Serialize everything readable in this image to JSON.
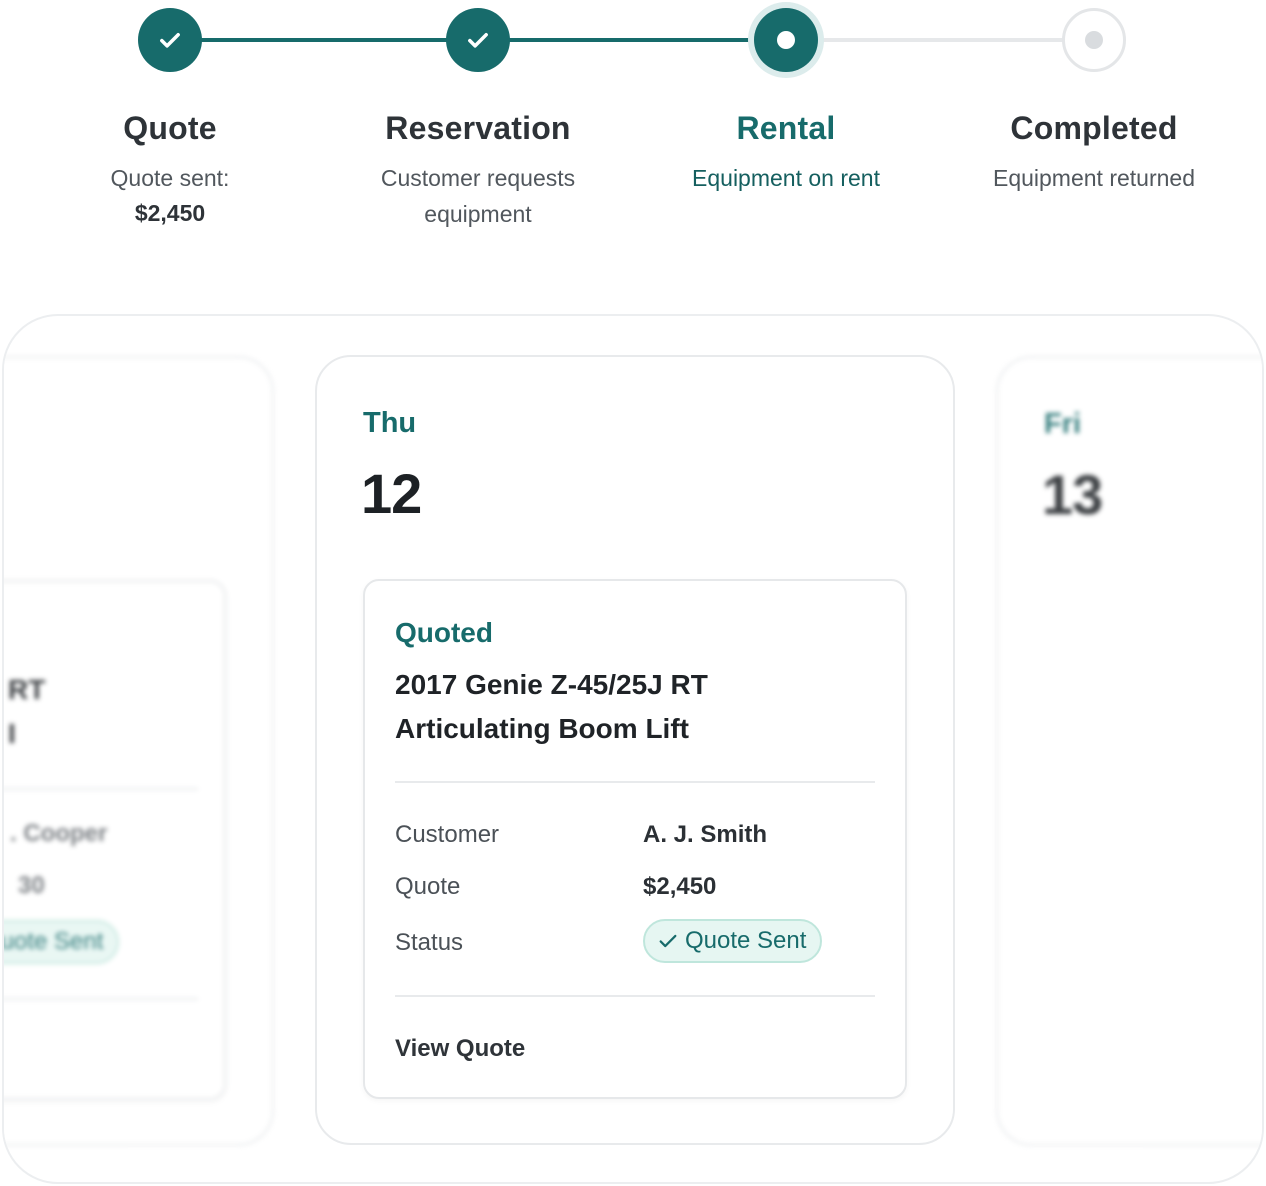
{
  "stepper": {
    "steps": [
      {
        "title": "Quote",
        "subtitle": "Quote sent:",
        "amount": "$2,450",
        "state": "done",
        "icon": "check-icon"
      },
      {
        "title": "Reservation",
        "subtitle_line1": "Customer requests",
        "subtitle_line2": "equipment",
        "state": "done",
        "icon": "check-icon"
      },
      {
        "title": "Rental",
        "subtitle": "Equipment on rent",
        "state": "current",
        "icon": "dot-icon"
      },
      {
        "title": "Completed",
        "subtitle": "Equipment returned",
        "state": "upcoming",
        "icon": "dot-icon"
      }
    ]
  },
  "calendar": {
    "prev_day": {
      "event": {
        "title_fragment_1": "RT",
        "title_fragment_2": "I",
        "customer_fragment": ". Cooper",
        "quote_fragment": "30",
        "status_fragment": "Quote Sent"
      }
    },
    "current_day": {
      "weekday": "Thu",
      "date": "12",
      "event": {
        "status": "Quoted",
        "title_line1": "2017 Genie Z-45/25J RT",
        "title_line2": "Articulating Boom Lift",
        "customer_label": "Customer",
        "customer_value": "A. J. Smith",
        "quote_label": "Quote",
        "quote_value": "$2,450",
        "status_label": "Status",
        "status_badge": "Quote Sent",
        "action_label": "View Quote"
      }
    },
    "next_day": {
      "weekday": "Fri",
      "date": "13"
    }
  },
  "colors": {
    "accent": "#176b6b",
    "badge_bg": "#e6f6f2",
    "badge_border": "#bfe6dc",
    "muted_line": "#e6e8ea"
  }
}
